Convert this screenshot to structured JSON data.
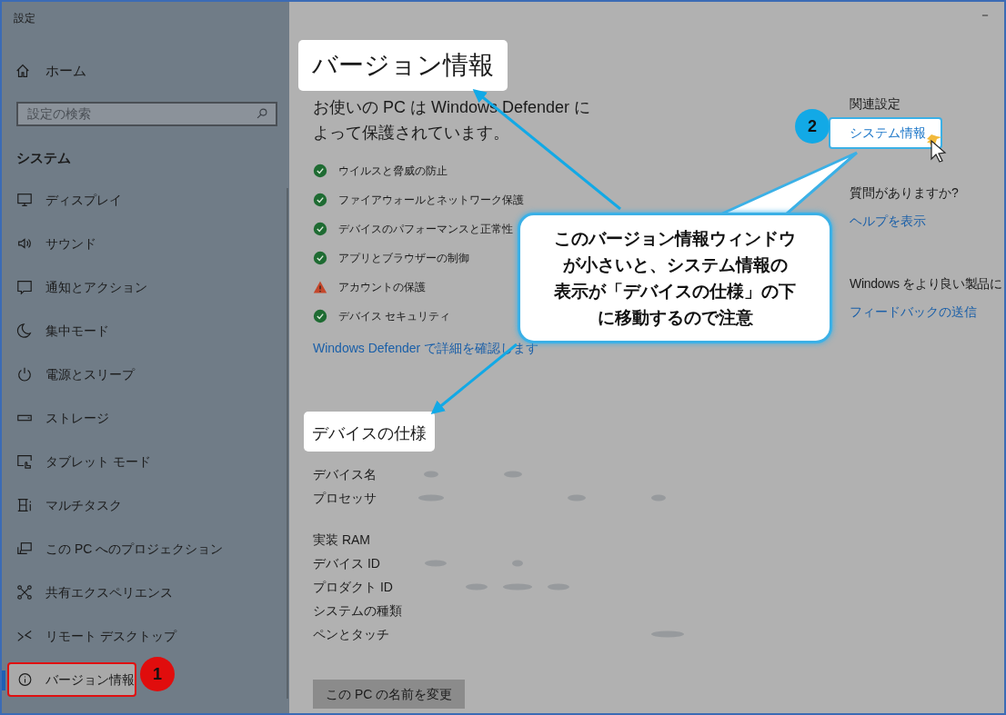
{
  "window": {
    "title": "設定",
    "minimize": "－"
  },
  "sidebar": {
    "home": "ホーム",
    "search": {
      "placeholder": "設定の検索"
    },
    "section": "システム",
    "items": [
      {
        "label": "ディスプレイ",
        "selected": false
      },
      {
        "label": "サウンド",
        "selected": false
      },
      {
        "label": "通知とアクション",
        "selected": false
      },
      {
        "label": "集中モード",
        "selected": false
      },
      {
        "label": "電源とスリープ",
        "selected": false
      },
      {
        "label": "ストレージ",
        "selected": false
      },
      {
        "label": "タブレット モード",
        "selected": false
      },
      {
        "label": "マルチタスク",
        "selected": false
      },
      {
        "label": "この PC へのプロジェクション",
        "selected": false
      },
      {
        "label": "共有エクスペリエンス",
        "selected": false
      },
      {
        "label": "リモート デスクトップ",
        "selected": false
      },
      {
        "label": "バージョン情報",
        "selected": true
      }
    ]
  },
  "main": {
    "heading": "バージョン情報",
    "protection_text": "お使いの PC は Windows Defender によって保護されています。",
    "status_items": [
      {
        "label": "ウイルスと脅威の防止",
        "kind": "ok"
      },
      {
        "label": "ファイアウォールとネットワーク保護",
        "kind": "ok"
      },
      {
        "label": "デバイスのパフォーマンスと正常性",
        "kind": "ok"
      },
      {
        "label": "アプリとブラウザーの制御",
        "kind": "ok"
      },
      {
        "label": "アカウントの保護",
        "kind": "warning"
      },
      {
        "label": "デバイス セキュリティ",
        "kind": "ok"
      }
    ],
    "defender_link": "Windows Defender で詳細を確認します",
    "specs_heading": "デバイスの仕様",
    "spec_groups": [
      [
        "デバイス名",
        "プロセッサ"
      ],
      [
        "実装 RAM",
        "デバイス ID",
        "プロダクト ID",
        "システムの種類",
        "ペンとタッチ"
      ]
    ],
    "rename_button": "この PC の名前を変更"
  },
  "related": {
    "heading": "関連設定",
    "link": "システム情報",
    "question": "質問がありますか?",
    "help_link": "ヘルプを表示",
    "feedback_heading": "Windows をより良い製品に",
    "feedback_link": "フィードバックの送信"
  },
  "annotations": {
    "badges": [
      "1",
      "2"
    ],
    "callout_lines": [
      "このバージョン情報ウィンドウ",
      "が小さいと、システム情報の",
      "表示が「デバイスの仕様」の下",
      "に移動するので注意"
    ]
  }
}
